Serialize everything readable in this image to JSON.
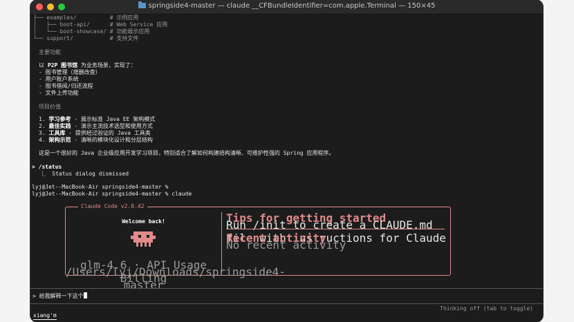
{
  "window": {
    "title": "springside4-master — claude __CFBundleIdentifier=com.apple.Terminal — 150×45"
  },
  "tree": [
    {
      "text": "├── examples/          # 示例应用"
    },
    {
      "text": "│   ├── boot-api/      # Web Service 应用"
    },
    {
      "text": "│   └── boot-showcase/ # 功能展示应用"
    },
    {
      "text": "└── support/           # 支持文件"
    }
  ],
  "features": {
    "heading": "主要功能",
    "intro_prefix": "以 ",
    "intro_bold": "P2P 图书馆",
    "intro_suffix": " 为业务场景，实现了：",
    "items": [
      "- 图书管理（增删改查）",
      "- 用户账户系统",
      "- 图书借阅/归还流程",
      "- 文件上传功能"
    ]
  },
  "value": {
    "heading": "项目价值",
    "items": [
      {
        "num": "1. ",
        "bold": "学习参考",
        "rest": " - 展示标准 Java EE 架构模式"
      },
      {
        "num": "2. ",
        "bold": "最佳实践",
        "rest": " - 演示主流技术选型和使用方式"
      },
      {
        "num": "3. ",
        "bold": "工具库",
        "rest": " - 提供经过验证的 Java 工具类"
      },
      {
        "num": "4. ",
        "bold": "架构示范",
        "rest": " - 清晰的模块化设计和分层结构"
      }
    ],
    "summary": "这是一个很好的 Java 企业级应用开发学习项目，特别适合了解如何构建结构清晰、可维护性强的 Spring 应用程序。"
  },
  "status": {
    "prompt": "> /status",
    "result": "  ⎿  Status dialog dismissed"
  },
  "shell": {
    "line1": "lyj@Jet--MacBook-Air springside4-master %",
    "line2": "lyj@Jet--MacBook-Air springside4-master % claude"
  },
  "claude_box": {
    "title": "Claude Code v2.0.42",
    "welcome": "Welcome back!",
    "model": "glm-4.6 · API Usage Billing",
    "path": "/Users/lyj/Downloads/springside4-master",
    "tips_heading": "Tips for getting started",
    "tips_text": "Run /init to create a CLAUDE.md file with instructions for Claude",
    "recent_heading": "Recent activity",
    "recent_text": "No recent activity"
  },
  "input": {
    "prompt": ">",
    "value": "给我解释一下这个"
  },
  "footer": {
    "thinking": "Thinking off (tab to toggle)",
    "ime_composition": "xiang'm"
  },
  "colors": {
    "accent": "#e08a8a",
    "background": "#1c1c1c"
  }
}
